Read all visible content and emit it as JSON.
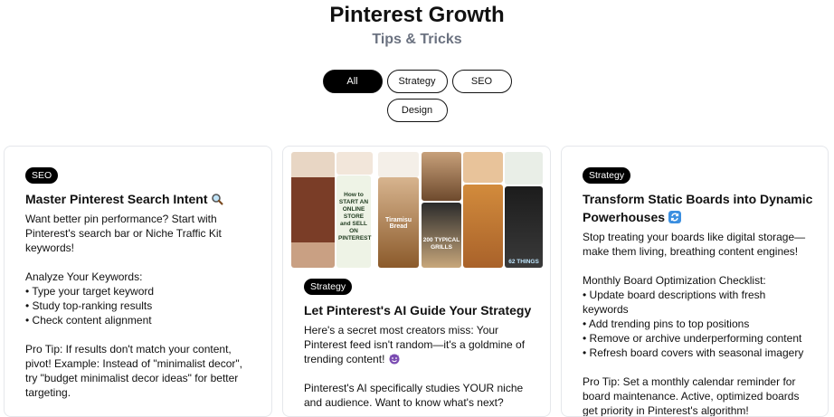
{
  "header": {
    "title": "Pinterest Growth",
    "subtitle": "Tips & Tricks"
  },
  "filters": [
    "All",
    "Strategy",
    "SEO",
    "Design"
  ],
  "cards": [
    {
      "badge": "SEO",
      "title": "Master Pinterest Search Intent",
      "title_icon": "magnifier-emoji-icon",
      "intro": "Want better pin performance? Start with Pinterest's search bar or Niche Traffic Kit keywords!",
      "list_heading": "Analyze Your Keywords:",
      "list": [
        "• Type your target keyword",
        "• Study top-ranking results",
        "• Check content alignment"
      ],
      "tip": "Pro Tip: If results don't match your content, pivot! Example: Instead of \"minimalist decor\", try \"budget minimalist decor ideas\" for better targeting."
    },
    {
      "badge": "Strategy",
      "title": "Let Pinterest's AI Guide Your Strategy",
      "intro": "Here's a secret most creators miss: Your Pinterest feed isn't random—it's a goldmine of trending content!",
      "intro_icon": "smiling-devil-emoji-icon",
      "para2": "Pinterest's AI specifically studies YOUR niche and audience. Want to know what's next?",
      "collage_text": {
        "pin1": "How to START AN ONLINE STORE and SELL ON PINTEREST",
        "pin2": "Tiramisu Bread",
        "pin3": "200 TYPICAL GRILLS",
        "pin4": "62 THINGS"
      }
    },
    {
      "badge": "Strategy",
      "title": "Transform Static Boards into Dynamic Powerhouses",
      "title_icon": "arrows-cycle-emoji-icon",
      "intro": "Stop treating your boards like digital storage—make them living, breathing content engines!",
      "list_heading": "Monthly Board Optimization Checklist:",
      "list": [
        "• Update board descriptions with fresh keywords",
        "• Add trending pins to top positions",
        "• Remove or archive underperforming content",
        "• Refresh board covers with seasonal imagery"
      ],
      "tip": "Pro Tip: Set a monthly calendar reminder for board maintenance. Active, optimized boards get priority in Pinterest's algorithm!"
    }
  ]
}
